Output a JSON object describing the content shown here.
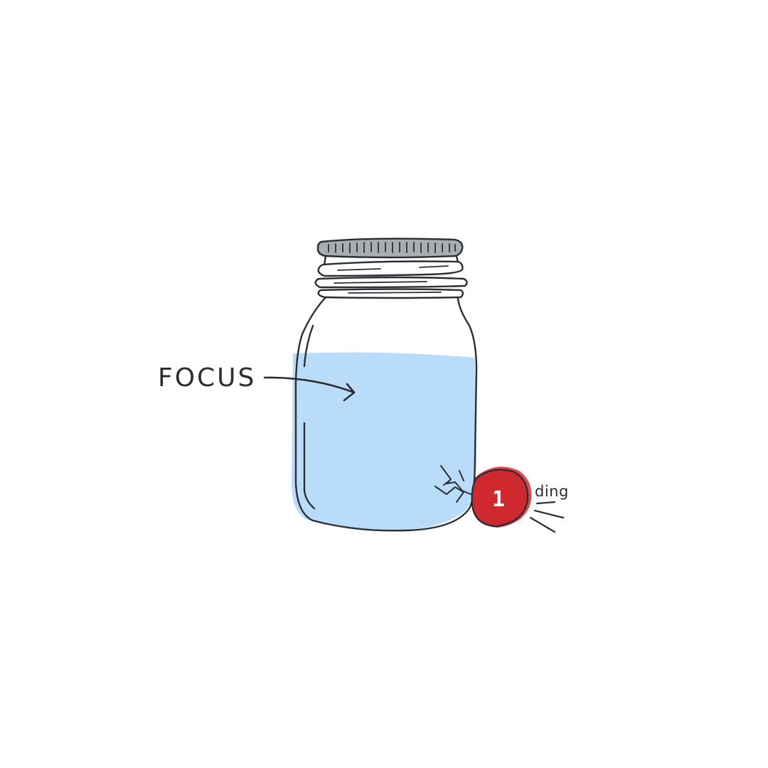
{
  "illustration": {
    "label": "FOCUS",
    "notification": {
      "count": "1",
      "sound": "ding"
    }
  },
  "colors": {
    "background": "#ffffff",
    "water": "#badcfb",
    "outline": "#2b2f33",
    "lid": "#a9adb1",
    "badge": "#d0282f",
    "badge_shadow": "#e0474c"
  },
  "icons": [
    "mason-jar-icon",
    "arrow-icon",
    "notification-badge-icon",
    "crack-icon",
    "sound-lines-icon"
  ]
}
